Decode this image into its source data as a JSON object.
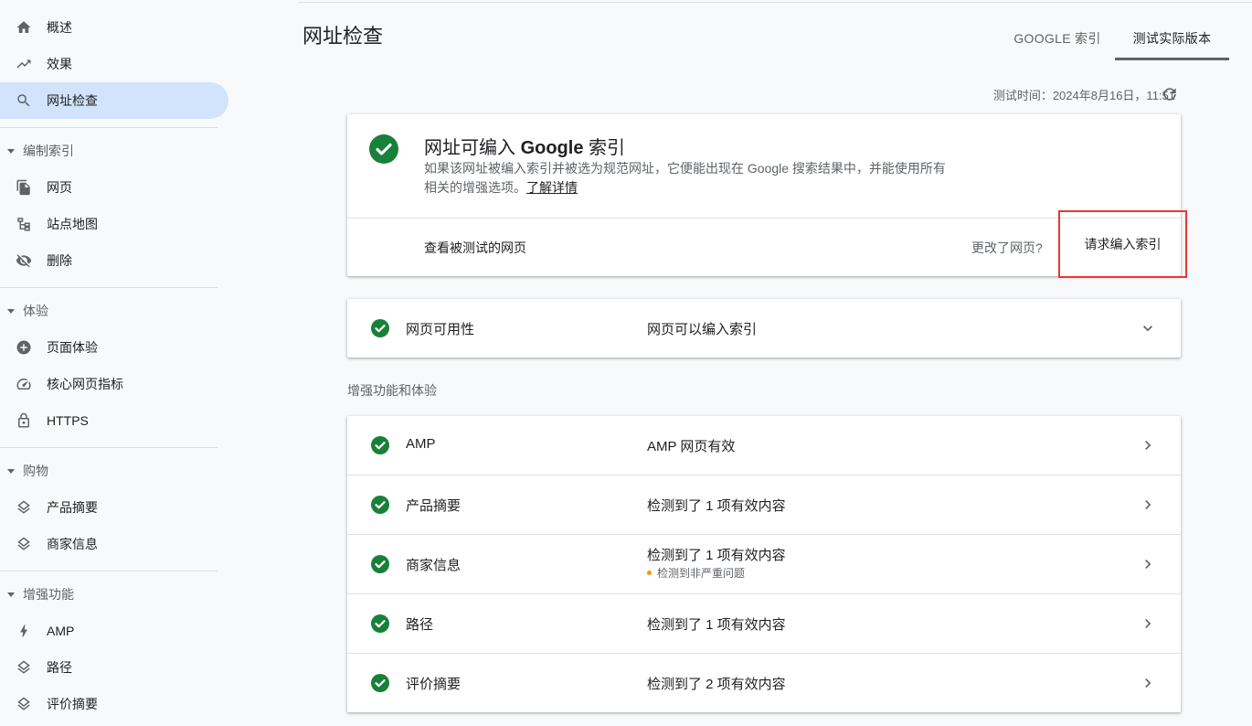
{
  "sidebar": {
    "items": [
      {
        "label": "概述",
        "icon": "home-icon"
      },
      {
        "label": "效果",
        "icon": "trending-up-icon"
      },
      {
        "label": "网址检查",
        "icon": "search-icon"
      }
    ],
    "groups": [
      {
        "label": "编制索引",
        "items": [
          {
            "label": "网页",
            "icon": "pages-icon"
          },
          {
            "label": "站点地图",
            "icon": "sitemap-icon"
          },
          {
            "label": "删除",
            "icon": "eye-off-icon"
          }
        ]
      },
      {
        "label": "体验",
        "items": [
          {
            "label": "页面体验",
            "icon": "plus-circle-icon"
          },
          {
            "label": "核心网页指标",
            "icon": "speed-icon"
          },
          {
            "label": "HTTPS",
            "icon": "lock-icon"
          }
        ]
      },
      {
        "label": "购物",
        "items": [
          {
            "label": "产品摘要",
            "icon": "layers-icon"
          },
          {
            "label": "商家信息",
            "icon": "layers-icon"
          }
        ]
      },
      {
        "label": "增强功能",
        "items": [
          {
            "label": "AMP",
            "icon": "bolt-icon"
          },
          {
            "label": "路径",
            "icon": "layers-icon"
          },
          {
            "label": "评价摘要",
            "icon": "layers-icon"
          }
        ]
      }
    ]
  },
  "header": {
    "title": "网址检查",
    "tabs": [
      {
        "label": "GOOGLE 索引"
      },
      {
        "label": "测试实际版本"
      }
    ],
    "test_time": "测试时间：2024年8月16日，11:51"
  },
  "status": {
    "title_prefix": "网址可编入 ",
    "title_bold": "Google",
    "title_suffix": " 索引",
    "description": "如果该网址被编入索引并被选为规范网址，它便能出现在 Google 搜索结果中，并能使用所有相关的增强选项。",
    "learn_more": "了解详情",
    "view_tested": "查看被测试的网页",
    "changed": "更改了网页?",
    "request_indexing": "请求编入索引"
  },
  "availability": {
    "label": "网页可用性",
    "value": "网页可以编入索引"
  },
  "enhancements": {
    "section_label": "增强功能和体验",
    "rows": [
      {
        "label": "AMP",
        "value": "AMP 网页有效",
        "sub": ""
      },
      {
        "label": "产品摘要",
        "value": "检测到了 1 项有效内容",
        "sub": ""
      },
      {
        "label": "商家信息",
        "value": "检测到了 1 项有效内容",
        "sub": "检测到非严重问题"
      },
      {
        "label": "路径",
        "value": "检测到了 1 项有效内容",
        "sub": ""
      },
      {
        "label": "评价摘要",
        "value": "检测到了 2 项有效内容",
        "sub": ""
      }
    ]
  },
  "colors": {
    "success": "#188038",
    "warning": "#f29900",
    "highlight": "#e53935",
    "active_nav": "#d2e3fc"
  }
}
